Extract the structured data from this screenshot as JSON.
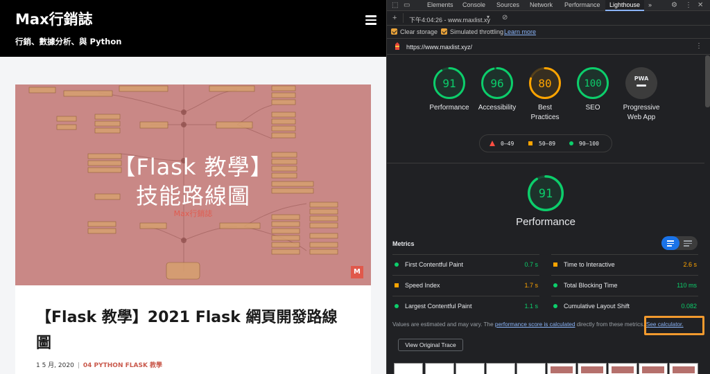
{
  "site": {
    "title": "Max行銷誌",
    "tagline": "行銷、數據分析、與 Python",
    "featured": {
      "title_line1": "【Flask 教學】",
      "title_line2": "技能路線圖",
      "brand": "Max行銷誌",
      "badge": "M"
    },
    "post": {
      "title": "【Flask 教學】2021 Flask 網頁開發路線圖",
      "date": "1 5 月, 2020",
      "category": "04 PYTHON FLASK 教學"
    }
  },
  "devtools": {
    "tabs": [
      "Elements",
      "Console",
      "Sources",
      "Network",
      "Performance",
      "Lighthouse"
    ],
    "active_tab": "Lighthouse",
    "more_tabs": "»",
    "report_select": "下午4:04:26 - www.maxlist.xy",
    "clear_storage_label": "Clear storage",
    "throttling_label": "Simulated throttling",
    "learn_more": "Learn more",
    "url": "https://www.maxlist.xyz/",
    "categories": [
      {
        "label": "Performance",
        "score": "91",
        "fraction": 0.91,
        "color": "#0cce6b"
      },
      {
        "label": "Accessibility",
        "score": "96",
        "fraction": 0.96,
        "color": "#0cce6b"
      },
      {
        "label": "Best Practices",
        "score": "80",
        "fraction": 0.8,
        "color": "#ffa400"
      },
      {
        "label": "SEO",
        "score": "100",
        "fraction": 1.0,
        "color": "#0cce6b"
      },
      {
        "label": "Progressive Web App",
        "score": "PWA",
        "color": "#9aa0a6"
      }
    ],
    "legend": {
      "fail": "0–49",
      "average": "50–89",
      "pass": "90–100"
    },
    "performance": {
      "score": "91",
      "fraction": 0.91,
      "title": "Performance"
    },
    "metrics_header": "Metrics",
    "metrics": [
      {
        "name": "First Contentful Paint",
        "value": "0.7 s",
        "status": "pass"
      },
      {
        "name": "Time to Interactive",
        "value": "2.6 s",
        "status": "average"
      },
      {
        "name": "Speed Index",
        "value": "1.7 s",
        "status": "average"
      },
      {
        "name": "Total Blocking Time",
        "value": "110 ms",
        "status": "pass"
      },
      {
        "name": "Largest Contentful Paint",
        "value": "1.1 s",
        "status": "pass"
      },
      {
        "name": "Cumulative Layout Shift",
        "value": "0.082",
        "status": "pass"
      }
    ],
    "metrics_note": {
      "prefix": "Values are estimated and may vary. The ",
      "link1": "performance score is calculated",
      "middle": " directly from these metrics. ",
      "link2": "See calculator."
    },
    "view_trace": "View Original Trace",
    "colors": {
      "pass": "#0cce6b",
      "average": "#ffa400",
      "fail": "#ff4e42",
      "highlight": "#f29a2e"
    }
  }
}
